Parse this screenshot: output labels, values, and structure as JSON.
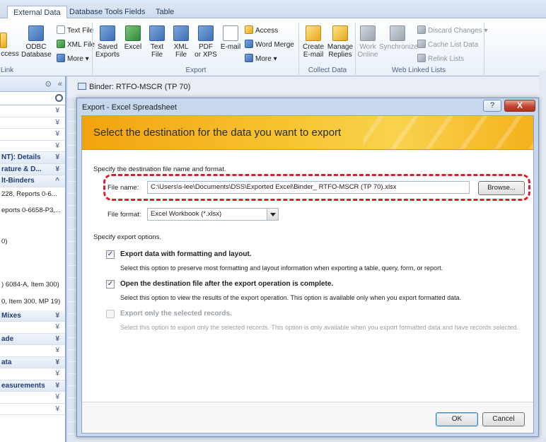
{
  "ribbon": {
    "tabs": [
      "External Data",
      "Database Tools",
      "Fields",
      "Table"
    ],
    "active_tab": "External Data",
    "buttons": {
      "access_partial": "ccess",
      "odbc_line1": "ODBC",
      "odbc_line2": "Database",
      "text_file": "Text File",
      "xml_file": "XML File",
      "more_import": "More",
      "saved_exports_1": "Saved",
      "saved_exports_2": "Exports",
      "excel": "Excel",
      "text_file_1": "Text",
      "text_file_2": "File",
      "xml_1": "XML",
      "xml_2": "File",
      "pdf_1": "PDF",
      "pdf_2": "or XPS",
      "email": "E-mail",
      "access_export": "Access",
      "word_merge": "Word Merge",
      "more_export": "More",
      "create_email_1": "Create",
      "create_email_2": "E-mail",
      "manage_1": "Manage",
      "manage_2": "Replies",
      "work_online_1": "Work",
      "work_online_2": "Online",
      "synchronize": "Synchronize",
      "discard_changes": "Discard Changes",
      "cache_list_data": "Cache List Data",
      "relink_lists": "Relink Lists"
    },
    "groups": {
      "link": "Link",
      "export": "Export",
      "collect": "Collect Data",
      "web_linked": "Web Linked Lists"
    }
  },
  "nav": {
    "rows": [
      {
        "type": "blank"
      },
      {
        "type": "blank"
      },
      {
        "type": "blank"
      },
      {
        "type": "blank"
      },
      {
        "type": "group",
        "label": "NT): Details"
      },
      {
        "type": "group",
        "label": "rature & D..."
      },
      {
        "type": "group",
        "label": "lt-Binders"
      }
    ],
    "items": [
      "228, Reports 0-6...",
      "eports 0-6658-P3,...",
      "",
      "0)",
      "",
      "",
      ") 6084-A, Item 300)",
      "0, Item 300, MP 19)"
    ],
    "groups_bottom": [
      {
        "label": "Mixes"
      },
      {
        "label": ""
      },
      {
        "label": "ade"
      },
      {
        "label": ""
      },
      {
        "label": "ata"
      },
      {
        "label": ""
      },
      {
        "label": "easurements"
      },
      {
        "label": ""
      },
      {
        "label": ""
      }
    ]
  },
  "document": {
    "tab_title": "Binder: RTFO-MSCR (TP 70)"
  },
  "dialog": {
    "title": "Export - Excel Spreadsheet",
    "help_symbol": "?",
    "close_symbol": "X",
    "banner": "Select the destination for the data you want to export",
    "spec_text": "Specify the destination file name and format.",
    "file_name_label": "File name:",
    "file_name_value": "C:\\Users\\s-lee\\Documents\\DSS\\Exported Excel\\Binder_ RTFO-MSCR (TP 70).xlsx",
    "browse_label": "Browse...",
    "file_format_label": "File format:",
    "file_format_value": "Excel Workbook (*.xlsx)",
    "options_text": "Specify export options.",
    "options": [
      {
        "label": "Export data with formatting and layout.",
        "checked": true,
        "enabled": true,
        "desc": "Select this option to preserve most formatting and layout information when exporting a table, query, form, or report."
      },
      {
        "label": "Open the destination file after the export operation is complete.",
        "checked": true,
        "enabled": true,
        "desc": "Select this option to view the results of the export operation. This option is available only when you export formatted data."
      },
      {
        "label": "Export only the selected records.",
        "checked": false,
        "enabled": false,
        "desc": "Select this option to export only the selected records. This option is only available when you export formatted data and have records selected."
      }
    ],
    "ok_label": "OK",
    "cancel_label": "Cancel",
    "highlight_color": "#d8202a"
  }
}
